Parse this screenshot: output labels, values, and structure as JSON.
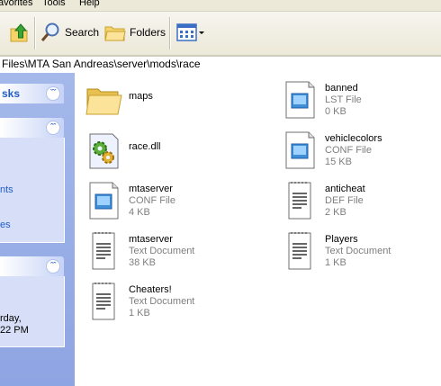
{
  "menu": {
    "favorites": "avorites",
    "tools": "Tools",
    "help": "Help"
  },
  "toolbar": {
    "search_label": "Search",
    "folders_label": "Folders"
  },
  "address": {
    "path": "Files\\MTA San Andreas\\server\\mods\\race"
  },
  "taskpane": {
    "panel1_title": "sks",
    "panel2_items": [
      "nts",
      "es"
    ],
    "panel3_lines": [
      "rday,",
      "22 PM"
    ]
  },
  "files": [
    {
      "name": "maps",
      "type": "",
      "size": "",
      "icon": "folder-icon"
    },
    {
      "name": "banned",
      "type": "LST File",
      "size": "0 KB",
      "icon": "generic-file-icon"
    },
    {
      "name": "race.dll",
      "type": "",
      "size": "",
      "icon": "dll-gear-icon"
    },
    {
      "name": "vehiclecolors",
      "type": "CONF File",
      "size": "15 KB",
      "icon": "generic-file-icon"
    },
    {
      "name": "mtaserver",
      "type": "CONF File",
      "size": "4 KB",
      "icon": "generic-file-icon"
    },
    {
      "name": "anticheat",
      "type": "DEF File",
      "size": "2 KB",
      "icon": "text-document-icon"
    },
    {
      "name": "mtaserver",
      "type": "Text Document",
      "size": "38 KB",
      "icon": "text-document-icon"
    },
    {
      "name": "Players",
      "type": "Text Document",
      "size": "1 KB",
      "icon": "text-document-icon"
    },
    {
      "name": "Cheaters!",
      "type": "Text Document",
      "size": "1 KB",
      "icon": "text-document-icon"
    }
  ]
}
